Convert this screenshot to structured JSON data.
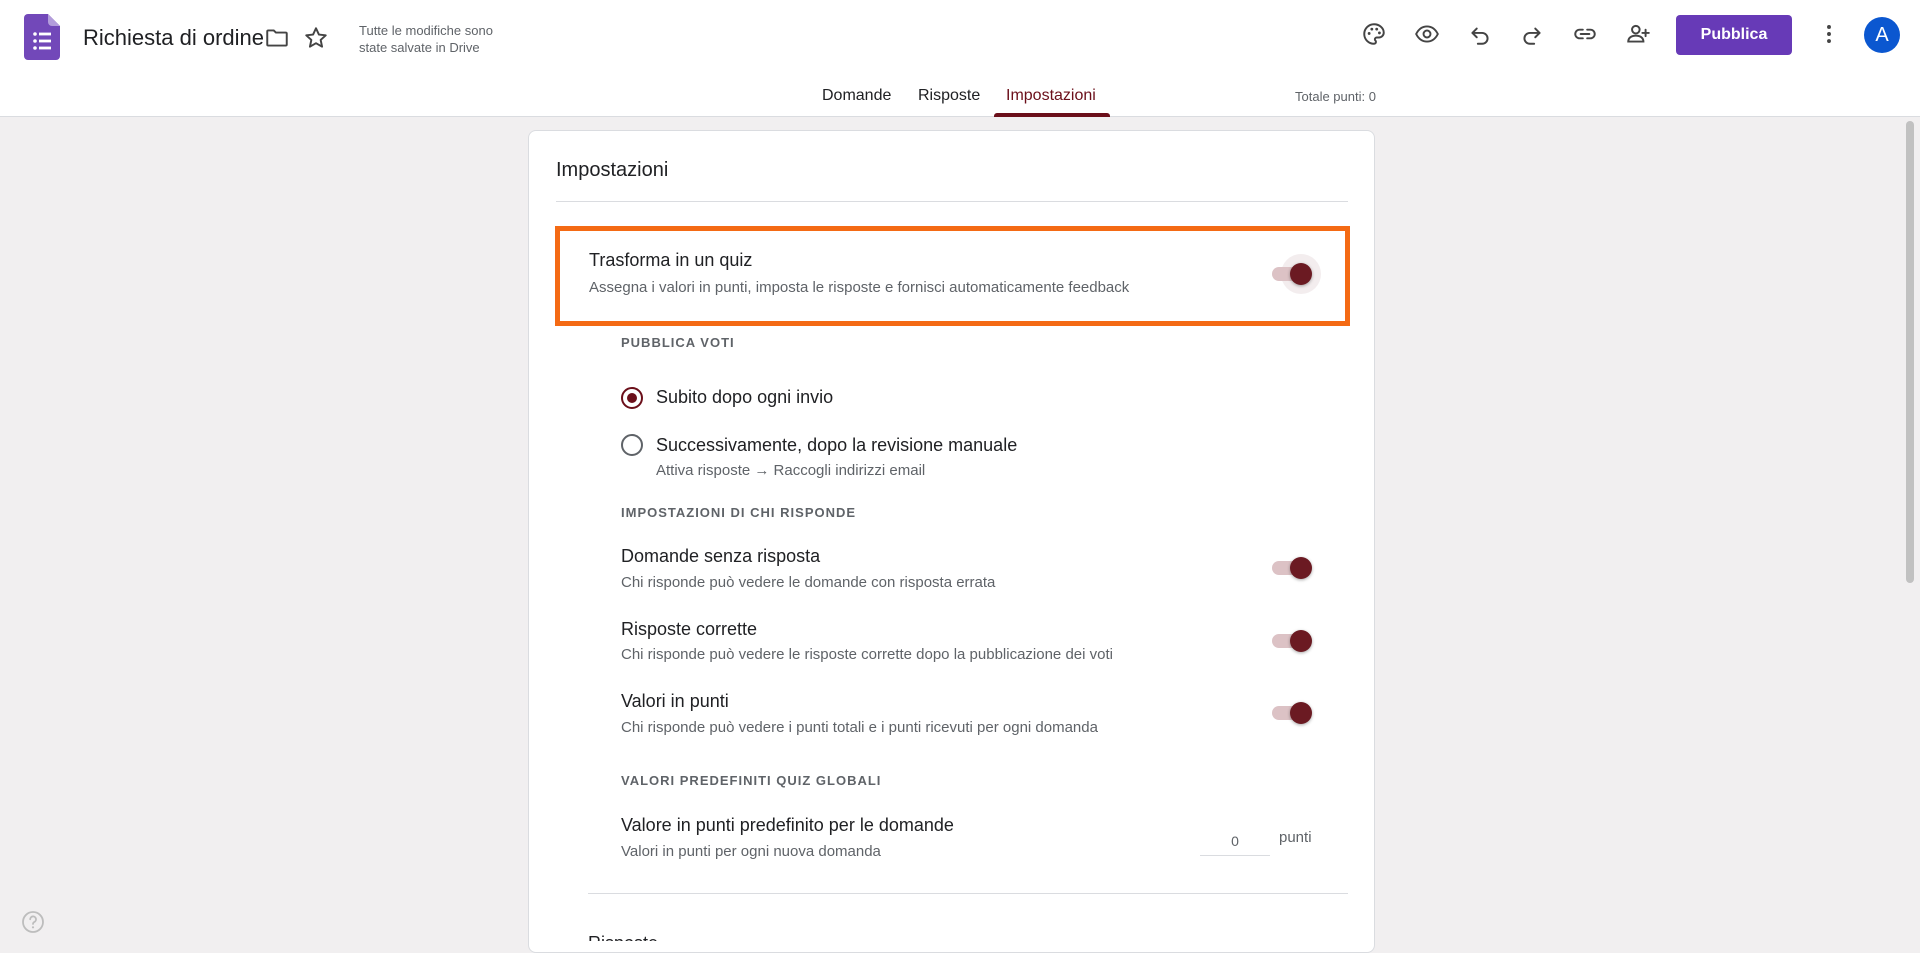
{
  "app": {
    "doc_title": "Richiesta di ordine",
    "save_status": "Tutte le modifiche sono state salvate in Drive",
    "publish_label": "Pubblica",
    "avatar_initial": "A",
    "icons": [
      "forms-logo-icon",
      "folder-icon",
      "star-icon",
      "palette-icon",
      "eye-icon",
      "undo-icon",
      "redo-icon",
      "link-icon",
      "add-person-icon",
      "more-vert-icon",
      "help-icon"
    ],
    "accent_color": "#673ab7",
    "theme_color": "#6b0f1a",
    "highlight_color": "#f46a14"
  },
  "tabs": [
    {
      "label": "Domande",
      "active": false
    },
    {
      "label": "Risposte",
      "active": false
    },
    {
      "label": "Impostazioni",
      "active": true
    }
  ],
  "total_points": "Totale punti: 0",
  "settings": {
    "title": "Impostazioni",
    "quiz": {
      "title": "Trasforma in un quiz",
      "desc": "Assegna i valori in punti, imposta le risposte e fornisci automaticamente feedback",
      "enabled": true
    },
    "publish_grades": {
      "label": "PUBBLICA VOTI",
      "options": [
        {
          "label": "Subito dopo ogni invio",
          "sub": "",
          "checked": true
        },
        {
          "label": "Successivamente, dopo la revisione manuale",
          "sub": "Attiva risposte → Raccogli indirizzi email",
          "checked": false
        }
      ]
    },
    "respondent": {
      "label": "IMPOSTAZIONI DI CHI RISPONDE",
      "items": [
        {
          "title": "Domande senza risposta",
          "desc": "Chi risponde può vedere le domande con risposta errata",
          "enabled": true
        },
        {
          "title": "Risposte corrette",
          "desc": "Chi risponde può vedere le risposte corrette dopo la pubblicazione dei voti",
          "enabled": true
        },
        {
          "title": "Valori in punti",
          "desc": "Chi risponde può vedere i punti totali e i punti ricevuti per ogni domanda",
          "enabled": true
        }
      ]
    },
    "defaults": {
      "label": "VALORI PREDEFINITI QUIZ GLOBALI",
      "title": "Valore in punti predefinito per le domande",
      "desc": "Valori in punti per ogni nuova domanda",
      "value": "0",
      "unit": "punti"
    },
    "next_section_title": "Risposte"
  }
}
